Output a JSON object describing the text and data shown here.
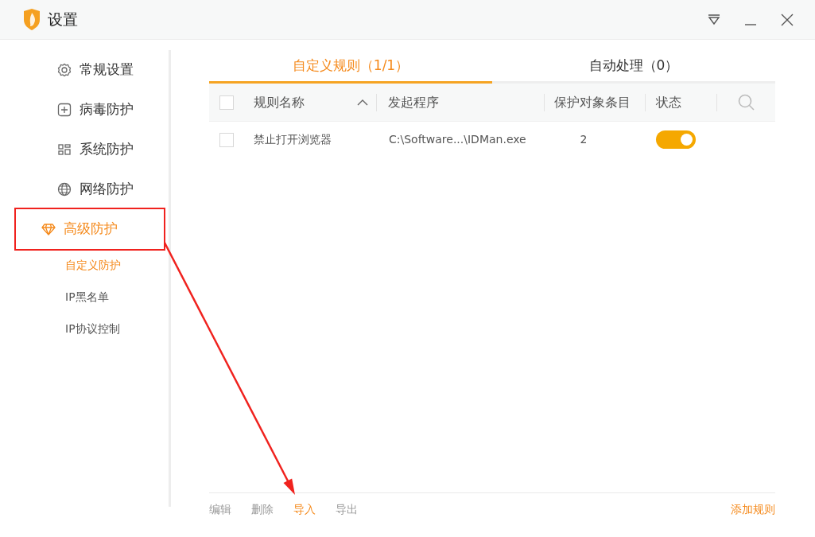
{
  "window": {
    "title": "设置"
  },
  "sidebar": {
    "items": [
      {
        "label": "常规设置",
        "selected": false,
        "highlighted": false
      },
      {
        "label": "病毒防护",
        "selected": false,
        "highlighted": false
      },
      {
        "label": "系统防护",
        "selected": false,
        "highlighted": false
      },
      {
        "label": "网络防护",
        "selected": false,
        "highlighted": false
      },
      {
        "label": "高级防护",
        "selected": true,
        "highlighted": true,
        "children": [
          {
            "label": "自定义防护",
            "selected": true
          },
          {
            "label": "IP黑名单",
            "selected": false
          },
          {
            "label": "IP协议控制",
            "selected": false
          }
        ]
      }
    ]
  },
  "tabs": [
    {
      "label": "自定义规则（1/1）",
      "selected": true
    },
    {
      "label": "自动处理（0）",
      "selected": false
    }
  ],
  "table": {
    "select_all_checked": false,
    "columns": [
      "规则名称",
      "发起程序",
      "保护对象条目",
      "状态"
    ],
    "rows": [
      {
        "checked": false,
        "name": "禁止打开浏览器",
        "program": "C:\\Software...\\IDMan.exe",
        "count": "2",
        "on": true
      }
    ]
  },
  "footer": {
    "actions": [
      {
        "label": "编辑",
        "hovered": false,
        "pointed": false
      },
      {
        "label": "删除",
        "hovered": false,
        "pointed": false
      },
      {
        "label": "导入",
        "hovered": true,
        "pointed": true
      },
      {
        "label": "导出",
        "hovered": false,
        "pointed": false
      }
    ],
    "add_button": "添加规则"
  }
}
